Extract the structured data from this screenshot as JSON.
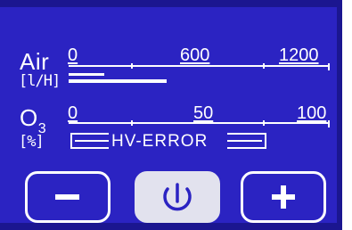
{
  "air": {
    "label": "Air",
    "unit": "[l/H]",
    "scale_min": "0",
    "scale_mid": "600",
    "scale_max": "1200",
    "fill_fraction": 0.21
  },
  "ozone": {
    "label_main": "O",
    "label_sub": "3",
    "unit": "[%]",
    "scale_min": "0",
    "scale_mid": "50",
    "scale_max": "100",
    "status": "HV-ERROR"
  },
  "buttons": {
    "minus": "minus-icon",
    "power": "power-icon",
    "plus": "plus-icon"
  },
  "colors": {
    "screen_bg": "#2b23c2",
    "foreground": "#ffffff",
    "active_button": "#e2e2ee",
    "power_icon": "#2b23c2"
  }
}
